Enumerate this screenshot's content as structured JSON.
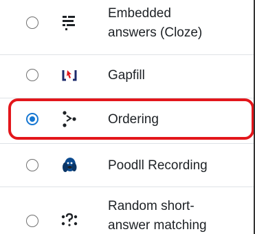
{
  "question_types": {
    "items": [
      {
        "label_line1": "Embedded",
        "label_line2": "answers (Cloze)",
        "icon": "cloze-icon",
        "selected": false
      },
      {
        "label": "Gapfill",
        "icon": "gapfill-icon",
        "selected": false
      },
      {
        "label": "Ordering",
        "icon": "ordering-icon",
        "selected": true
      },
      {
        "label": "Poodll Recording",
        "icon": "poodll-icon",
        "selected": false
      },
      {
        "label_line1": "Random short-",
        "label_line2": "answer matching",
        "icon": "random-match-icon",
        "selected": false
      }
    ]
  },
  "colors": {
    "highlight": "#e3161b",
    "radio_selected": "#1677d2",
    "text": "#1d2125"
  }
}
